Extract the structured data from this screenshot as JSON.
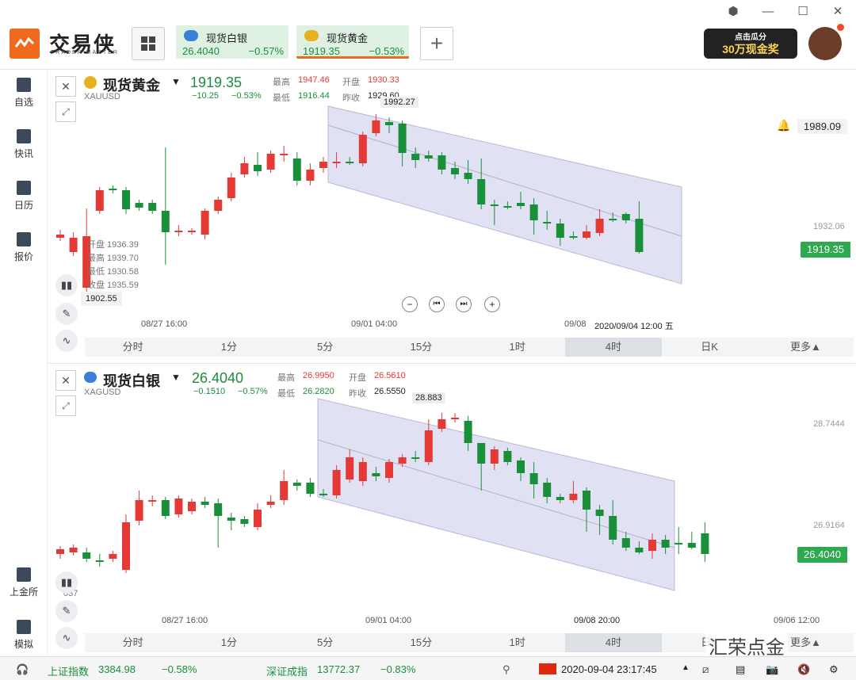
{
  "app": {
    "name": "交易侠",
    "subtitle": "TRADER MASTER"
  },
  "window_controls": [
    "settings-icon",
    "minimize-icon",
    "maximize-icon",
    "close-icon"
  ],
  "quote_tabs": [
    {
      "name": "现货白银",
      "price": "26.4040",
      "change_pct": "−0.57%"
    },
    {
      "name": "现货黄金",
      "price": "1919.35",
      "change_pct": "−0.53%"
    }
  ],
  "ad": {
    "line1": "点击瓜分",
    "line2": "30万现金奖"
  },
  "sidebar": {
    "items": [
      {
        "label": "自选",
        "icon": "star-icon"
      },
      {
        "label": "快讯",
        "icon": "news-icon"
      },
      {
        "label": "日历",
        "icon": "calendar-icon"
      },
      {
        "label": "报价",
        "icon": "quote-icon"
      }
    ],
    "bottom_items": [
      {
        "label": "上金所",
        "icon": "exchange-icon"
      },
      {
        "label": "模拟",
        "icon": "simulate-icon"
      }
    ]
  },
  "timeframes": [
    "分时",
    "1分",
    "5分",
    "15分",
    "1时",
    "4时",
    "日K",
    "更多▲"
  ],
  "active_timeframe": "4时",
  "gold": {
    "name": "现货黄金",
    "code": "XAUUSD",
    "price": "1919.35",
    "change": "−10.25",
    "change_pct": "−0.53%",
    "high_label": "最高",
    "high": "1947.46",
    "open_label": "开盘",
    "open": "1930.33",
    "low_label": "最低",
    "low": "1916.44",
    "prev_label": "昨收",
    "prev": "1929.60",
    "ohlc_tooltip": {
      "open": "开盘 1936.39",
      "high": "最高 1939.70",
      "low": "最低 1930.58",
      "close": "收盘 1935.59"
    },
    "peak_label": "1992.27",
    "cursor_price": "1902.55",
    "alert_price": "1989.09",
    "axis_mid": "1932.06",
    "x_labels": [
      "08/27 16:00",
      "09/01 04:00",
      "2020/09/04 12:00 五"
    ],
    "x_short": "09/08"
  },
  "silver": {
    "name": "现货白银",
    "code": "XAGUSD",
    "price": "26.4040",
    "change": "−0.1510",
    "change_pct": "−0.57%",
    "high_label": "最高",
    "high": "26.9950",
    "open_label": "开盘",
    "open": "26.5610",
    "low_label": "最低",
    "low": "26.2820",
    "prev_label": "昨收",
    "prev": "26.5550",
    "peak_label": "28.883",
    "axis_top": "28.7444",
    "axis_mid": "26.9164",
    "cursor_price": "037",
    "x_labels": [
      "08/27 16:00",
      "09/01 04:00",
      "09/06 12:00"
    ],
    "x_mid2": "09/08 20:00"
  },
  "status": {
    "sh_label": "上证指数",
    "sh_value": "3384.98",
    "sh_pct": "−0.58%",
    "sz_label": "深证成指",
    "sz_value": "13772.37",
    "sz_pct": "−0.83%",
    "datetime": "2020-09-04 23:17:45"
  },
  "watermark": "汇荣点金",
  "colors": {
    "up": "#e53935",
    "down": "#1a8f3a",
    "channel": "#d5d5ee",
    "accent": "#ef6a1f"
  }
}
